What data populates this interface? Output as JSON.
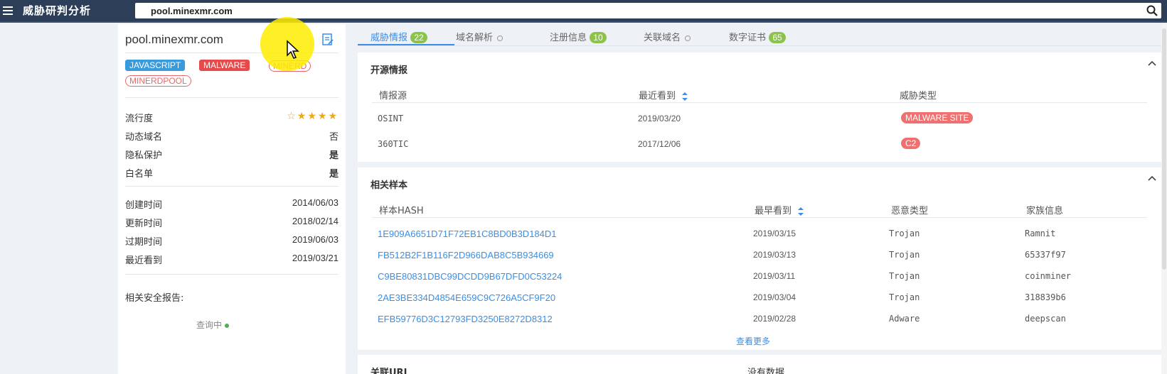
{
  "app": {
    "title": "威胁研判分析"
  },
  "search": {
    "value": "pool.minexmr.com"
  },
  "sidebar": {
    "domain": "pool.minexmr.com",
    "tags": [
      "JAVASCRIPT",
      "MALWARE",
      "MINERD",
      "MINERDPOOL"
    ],
    "popularity_label": "流行度",
    "popularity_stars": 4,
    "flags": [
      {
        "label": "动态域名",
        "value": "否"
      },
      {
        "label": "隐私保护",
        "value": "是"
      },
      {
        "label": "白名单",
        "value": "是"
      }
    ],
    "dates": [
      {
        "label": "创建时间",
        "value": "2014/06/03"
      },
      {
        "label": "更新时间",
        "value": "2018/02/14"
      },
      {
        "label": "过期时间",
        "value": "2019/06/03"
      },
      {
        "label": "最近看到",
        "value": "2019/03/21"
      }
    ],
    "reports_label": "相关安全报告:",
    "querying": "查询中"
  },
  "tabs": [
    {
      "label": "威胁情报",
      "badge": "22"
    },
    {
      "label": "域名解析",
      "badge": ""
    },
    {
      "label": "注册信息",
      "badge": "10"
    },
    {
      "label": "关联域名",
      "badge": ""
    },
    {
      "label": "数字证书",
      "badge": "65"
    }
  ],
  "intel": {
    "title": "开源情报",
    "headers": [
      "情报源",
      "最近看到",
      "威胁类型"
    ],
    "rows": [
      {
        "source": "OSINT",
        "date": "2019/03/20",
        "type": "MALWARE SITE"
      },
      {
        "source": "360TIC",
        "date": "2017/12/06",
        "type": "C2"
      }
    ]
  },
  "samples": {
    "title": "相关样本",
    "headers": [
      "样本HASH",
      "最早看到",
      "恶意类型",
      "家族信息"
    ],
    "rows": [
      {
        "hash": "1E909A6651D71F72EB1C8BD0B3D184D1",
        "date": "2019/03/15",
        "type": "Trojan",
        "family": "Ramnit"
      },
      {
        "hash": "FB512B2F1B116F2D966DAB8C5B934669",
        "date": "2019/03/13",
        "type": "Trojan",
        "family": "65337f97"
      },
      {
        "hash": "C9BE80831DBC99DCDD9B67DFD0C53224",
        "date": "2019/03/11",
        "type": "Trojan",
        "family": "coinminer"
      },
      {
        "hash": "2AE3BE334D4854E659C9C726A5CF9F20",
        "date": "2019/03/04",
        "type": "Trojan",
        "family": "318839b6"
      },
      {
        "hash": "EFB59776D3C12793FD3250E8272D8312",
        "date": "2019/02/28",
        "type": "Adware",
        "family": "deepscan"
      }
    ],
    "more": "查看更多"
  },
  "related_url": {
    "title": "关联URL",
    "empty": "没有数据"
  }
}
